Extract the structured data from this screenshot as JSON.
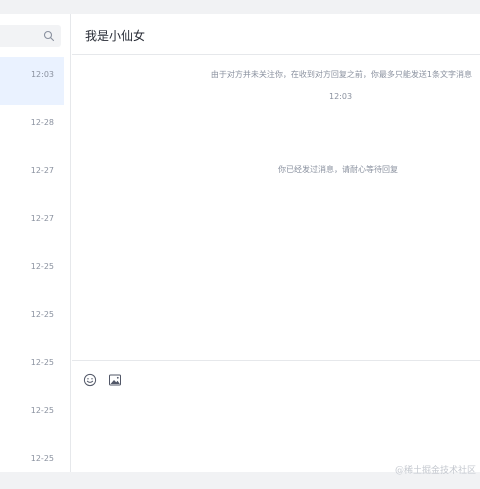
{
  "search": {
    "placeholder": "",
    "icon": "search-icon"
  },
  "conversations": [
    {
      "time": "12:03",
      "active": true
    },
    {
      "time": "12-28"
    },
    {
      "time": "12-27"
    },
    {
      "time": "12-27"
    },
    {
      "time": "12-25"
    },
    {
      "time": "12-25"
    },
    {
      "time": "12-25"
    },
    {
      "time": "12-25"
    },
    {
      "time": "12-25"
    }
  ],
  "chat": {
    "title": "我是小仙女",
    "notice": "由于对方并未关注你，在收到对方回复之前，你最多只能发送1条文字消息",
    "message_time": "12:03",
    "sent_notice": "你已经发过消息，请耐心等待回复"
  },
  "composer": {
    "emoji_icon": "emoji-icon",
    "image_icon": "image-icon",
    "placeholder": ""
  },
  "watermark": "@稀土掘金技术社区",
  "colors": {
    "accent_bg": "#eaf2ff",
    "muted_text": "#8a919f",
    "divider": "#e6e8eb"
  }
}
